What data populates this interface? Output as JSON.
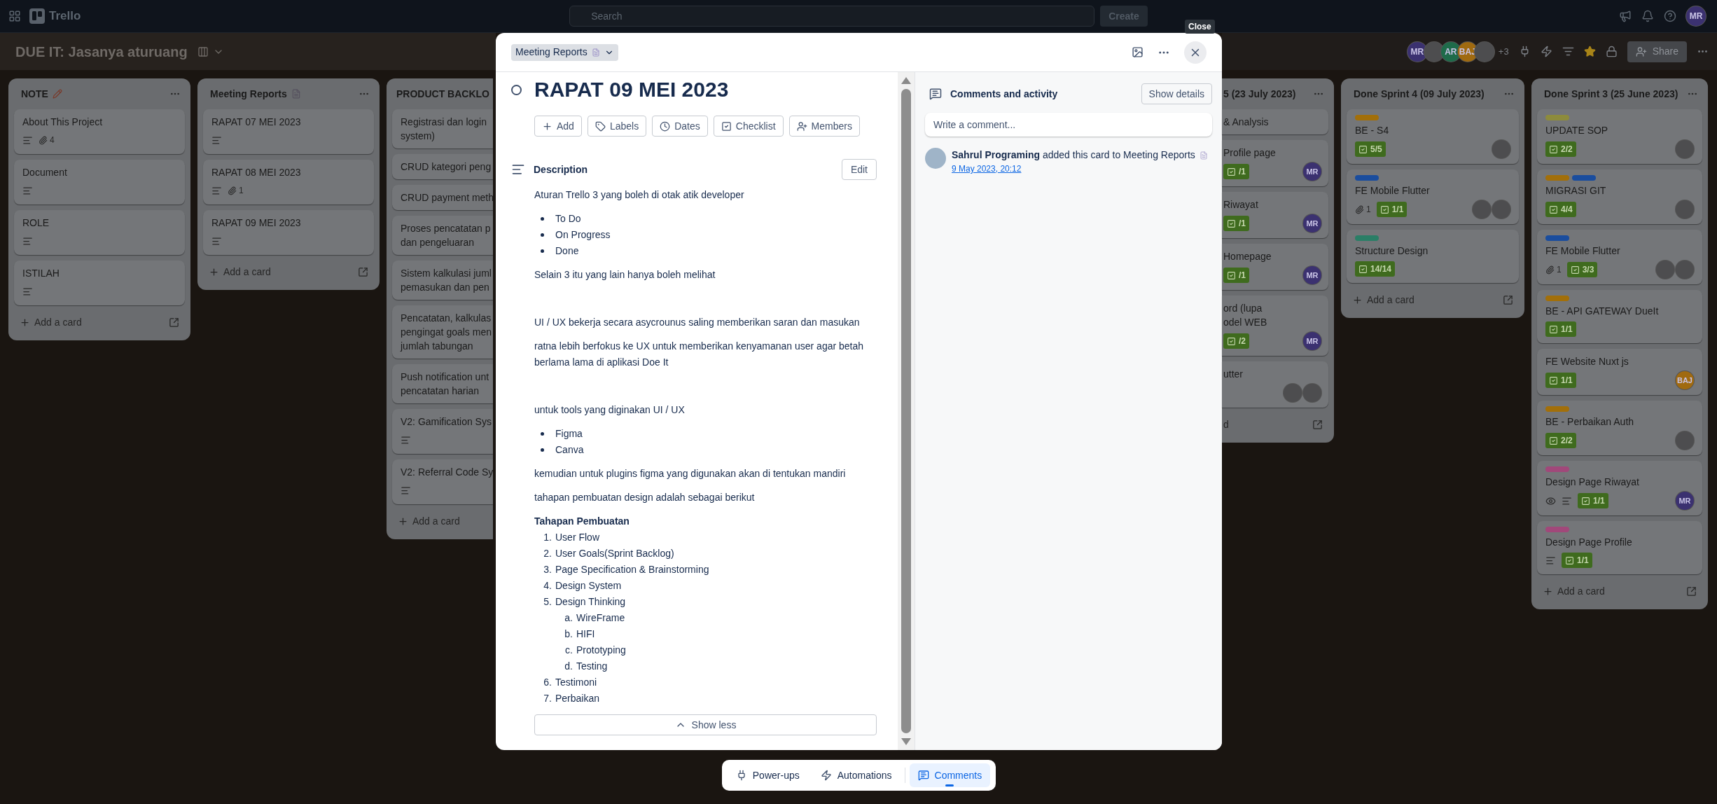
{
  "topbar": {
    "app_name": "Trello",
    "search": {
      "placeholder": "Search"
    },
    "create_label": "Create",
    "avatar": {
      "kind": "initials",
      "text": "MR",
      "color": "#3b3170"
    }
  },
  "board": {
    "title": "DUE IT: Jasanya aturuang",
    "members": [
      {
        "kind": "initials",
        "text": "MR",
        "color": "#3b3170"
      },
      {
        "kind": "photo"
      },
      {
        "kind": "initials",
        "text": "AR",
        "color": "#1e6b4a"
      },
      {
        "kind": "initials",
        "text": "BAJ",
        "color": "#a06a10"
      },
      {
        "kind": "photo"
      }
    ],
    "more_members": "+3",
    "starred": true,
    "share_label": "Share"
  },
  "lists_left": [
    {
      "title": "NOTE",
      "kind": "pencil",
      "clipped": false,
      "add_label": "Add a card",
      "cards": [
        {
          "title": "About This Project",
          "description": true,
          "attachments": "4"
        },
        {
          "title": "Document",
          "description": true
        },
        {
          "title": "ROLE",
          "description": true
        },
        {
          "title": "ISTILAH",
          "description": true
        }
      ]
    },
    {
      "title": "Meeting Reports",
      "kind": "document",
      "clipped": false,
      "add_label": "Add a card",
      "cards": [
        {
          "title": "RAPAT 07 MEI 2023",
          "description": true
        },
        {
          "title": "RAPAT 08 MEI 2023",
          "description": true,
          "attachments": "1"
        },
        {
          "title": "RAPAT 09 MEI 2023",
          "description": true
        }
      ]
    },
    {
      "title": "PRODUCT BACKLO",
      "clipped": true,
      "add_label": "Add a card",
      "cards": [
        {
          "title": "Registrasi dan login\nsystem)"
        },
        {
          "title": "CRUD kategori peng"
        },
        {
          "title": "CRUD payment meth"
        },
        {
          "title": "Proses pencatatan p\ndan pengeluaran"
        },
        {
          "title": "Sistem kalkulasi juml\npemasukan dan pen"
        },
        {
          "title": "Pencatatan, kalkulas\npengingat goals men\njumlah tabungan"
        },
        {
          "title": "Push notification unt\npencatatan harian"
        },
        {
          "title": "V2: Gamification Sys",
          "description": true
        },
        {
          "title": "V2: Referral Code Sy",
          "description": true
        }
      ]
    }
  ],
  "card_modal": {
    "list_name": "Meeting Reports",
    "title": "RAPAT 09 MEI 2023",
    "complete": false,
    "actions": [
      {
        "kind": "add",
        "label": "Add"
      },
      {
        "kind": "labels",
        "label": "Labels"
      },
      {
        "kind": "dates",
        "label": "Dates"
      },
      {
        "kind": "checklist",
        "label": "Checklist"
      },
      {
        "kind": "members",
        "label": "Members"
      }
    ],
    "description_title": "Description",
    "edit_label": "Edit",
    "description": [
      {
        "kind": "paragraph",
        "text": "Aturan Trello 3 yang boleh di otak atik developer"
      },
      {
        "kind": "bullets",
        "items": [
          "To Do",
          "On Progress",
          "Done"
        ]
      },
      {
        "kind": "paragraph",
        "text": "Selain 3 itu yang lain hanya boleh melihat"
      },
      {
        "kind": "blank"
      },
      {
        "kind": "paragraph",
        "text": "UI / UX bekerja secara asycrounus saling memberikan saran dan masukan"
      },
      {
        "kind": "paragraph",
        "text": "ratna lebih berfokus ke UX untuk memberikan kenyamanan user agar betah berlama lama di aplikasi Doe It"
      },
      {
        "kind": "blank"
      },
      {
        "kind": "paragraph",
        "text": "untuk tools yang diginakan UI / UX"
      },
      {
        "kind": "bullets",
        "items": [
          "Figma",
          "Canva"
        ]
      },
      {
        "kind": "paragraph",
        "text": "kemudian untuk plugins figma yang digunakan akan di tentukan mandiri"
      },
      {
        "kind": "paragraph",
        "text": "tahapan pembuatan design adalah sebagai berikut"
      },
      {
        "kind": "heading",
        "text": "Tahapan Pembuatan"
      },
      {
        "kind": "numbered",
        "items": [
          {
            "marker": "1.",
            "text": "User Flow"
          },
          {
            "marker": "2.",
            "text": "User Goals(Sprint Backlog)"
          },
          {
            "marker": "3.",
            "text": "Page Specification & Brainstorming"
          },
          {
            "marker": "4.",
            "text": "Design System"
          },
          {
            "marker": "5.",
            "text": "Design Thinking",
            "children": [
              {
                "marker": "a.",
                "text": "WireFrame"
              },
              {
                "marker": "b.",
                "text": "HIFI"
              },
              {
                "marker": "c.",
                "text": "Prototyping"
              },
              {
                "marker": "d.",
                "text": "Testing"
              }
            ]
          },
          {
            "marker": "6.",
            "text": "Testimoni"
          },
          {
            "marker": "7.",
            "text": "Perbaikan"
          }
        ]
      }
    ],
    "show_less_label": "Show less",
    "activity_title": "Comments and activity",
    "show_details_label": "Show details",
    "comment": {
      "placeholder": "Write a comment..."
    },
    "activity": [
      {
        "text": "**Sahrul Programing** added this card to Meeting Reports",
        "time": "9 May 2023, 20:12"
      }
    ]
  },
  "tooltip": "Close",
  "bottom_bar": [
    {
      "kind": "powerups",
      "label": "Power-ups",
      "selected": false
    },
    {
      "kind": "automations",
      "label": "Automations",
      "selected": false
    },
    {
      "kind": "comments",
      "label": "Comments",
      "selected": true
    }
  ],
  "lists_right": [
    {
      "title": "5 (23 July 2023)",
      "clipped": true,
      "add_label": "d",
      "cards": [
        {
          "title": "& Analysis"
        },
        {
          "title": "Profile page",
          "checklist": "/1",
          "members": [
            {
              "kind": "initials",
              "text": "MR",
              "color": "#3b3170"
            }
          ]
        },
        {
          "title": "Riwayat",
          "checklist": "/1",
          "members": [
            {
              "kind": "initials",
              "text": "MR",
              "color": "#3b3170"
            }
          ]
        },
        {
          "title": "Homepage",
          "checklist": "/1",
          "members": [
            {
              "kind": "initials",
              "text": "MR",
              "color": "#3b3170"
            }
          ]
        },
        {
          "title": "ord (lupa\nodel WEB",
          "checklist": "/2",
          "members": [
            {
              "kind": "initials",
              "text": "MR",
              "color": "#3b3170"
            }
          ]
        },
        {
          "title": "utter",
          "members": [
            {
              "kind": "photo"
            },
            {
              "kind": "photo"
            }
          ]
        }
      ]
    },
    {
      "title": "Done Sprint 4 (09 July 2023)",
      "clipped": false,
      "add_label": "Add a card",
      "cards": [
        {
          "title": "BE - S4",
          "labels": [
            {
              "color": "#a26f0a"
            }
          ],
          "checklist": "5/5",
          "members": [
            {
              "kind": "photo"
            }
          ]
        },
        {
          "title": "FE Mobile Flutter",
          "labels": [
            {
              "color": "#1a4d9e"
            }
          ],
          "attachments": "1",
          "checklist": "1/1",
          "members": [
            {
              "kind": "photo"
            },
            {
              "kind": "photo"
            }
          ]
        },
        {
          "title": "Structure Design",
          "labels": [
            {
              "color": "#2a7e66"
            }
          ],
          "checklist": "14/14"
        }
      ]
    },
    {
      "title": "Done Sprint 3 (25 June 2023)",
      "clipped": false,
      "add_label": "Add a card",
      "cards": [
        {
          "title": "UPDATE SOP",
          "labels": [
            {
              "color": "#8d8b3c"
            }
          ],
          "checklist": "2/2",
          "members": [
            {
              "kind": "photo"
            }
          ]
        },
        {
          "title": "MIGRASI GIT",
          "labels": [
            {
              "color": "#a26f0a"
            },
            {
              "color": "#1a4d9e"
            }
          ],
          "checklist": "4/4",
          "members": [
            {
              "kind": "photo"
            }
          ]
        },
        {
          "title": "FE Mobile Flutter",
          "labels": [
            {
              "color": "#1a4d9e"
            }
          ],
          "attachments": "1",
          "checklist": "3/3",
          "members": [
            {
              "kind": "photo"
            },
            {
              "kind": "photo"
            }
          ]
        },
        {
          "title": "BE - API GATEWAY DueIt",
          "labels": [
            {
              "color": "#a26f0a"
            }
          ],
          "checklist": "1/1"
        },
        {
          "title": "FE Website Nuxt js",
          "checklist": "1/1",
          "members": [
            {
              "kind": "initials",
              "text": "BAJ",
              "color": "#a06a10"
            }
          ]
        },
        {
          "title": "BE - Perbaikan Auth",
          "labels": [
            {
              "color": "#a26f0a"
            }
          ],
          "checklist": "2/2",
          "members": [
            {
              "kind": "photo"
            }
          ]
        },
        {
          "title": "Design Page Riwayat",
          "labels": [
            {
              "color": "#a1487a"
            }
          ],
          "watching": true,
          "description": true,
          "checklist": "1/1",
          "members": [
            {
              "kind": "initials",
              "text": "MR",
              "color": "#3b3170"
            }
          ]
        },
        {
          "title": "Design Page Profile",
          "labels": [
            {
              "color": "#a1487a"
            }
          ],
          "description": true,
          "checklist": "1/1"
        }
      ]
    }
  ]
}
